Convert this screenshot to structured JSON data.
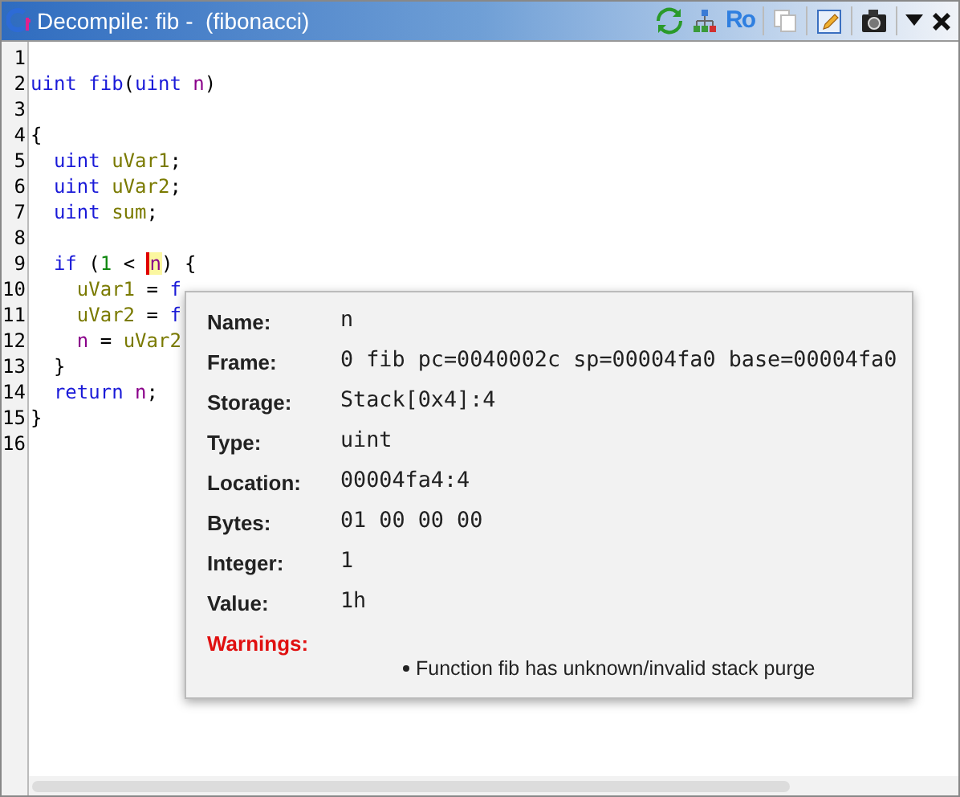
{
  "window": {
    "title": "Decompile: fib -  (fibonacci)"
  },
  "toolbar": {
    "read_only_label": "Ro"
  },
  "code": [
    {
      "number": "1"
    },
    {
      "number": "2",
      "tokens": [
        {
          "kind": "keyword",
          "text": "uint fib"
        },
        {
          "kind": "plain",
          "text": "("
        },
        {
          "kind": "keyword",
          "text": "uint "
        },
        {
          "kind": "param",
          "text": "n"
        },
        {
          "kind": "plain",
          "text": ")"
        }
      ]
    },
    {
      "number": "3"
    },
    {
      "number": "4",
      "tokens": [
        {
          "kind": "plain",
          "text": "{"
        }
      ]
    },
    {
      "number": "5",
      "tokens": [
        {
          "kind": "keyword",
          "text": "  uint "
        },
        {
          "kind": "var",
          "text": "uVar1"
        },
        {
          "kind": "plain",
          "text": ";"
        }
      ]
    },
    {
      "number": "6",
      "tokens": [
        {
          "kind": "keyword",
          "text": "  uint "
        },
        {
          "kind": "var",
          "text": "uVar2"
        },
        {
          "kind": "plain",
          "text": ";"
        }
      ]
    },
    {
      "number": "7",
      "tokens": [
        {
          "kind": "keyword",
          "text": "  uint "
        },
        {
          "kind": "var",
          "text": "sum"
        },
        {
          "kind": "plain",
          "text": ";"
        }
      ]
    },
    {
      "number": "8"
    },
    {
      "number": "9",
      "tokens": [
        {
          "kind": "keyword",
          "text": "  if"
        },
        {
          "kind": "plain",
          "text": " ("
        },
        {
          "kind": "number",
          "text": "1"
        },
        {
          "kind": "plain",
          "text": " < "
        },
        {
          "kind": "param",
          "text": "n",
          "cursor": true
        },
        {
          "kind": "plain",
          "text": ") {"
        }
      ]
    },
    {
      "number": "10",
      "tokens": [
        {
          "kind": "var",
          "text": "    uVar1"
        },
        {
          "kind": "plain",
          "text": " = "
        },
        {
          "kind": "keyword",
          "text": "f"
        }
      ]
    },
    {
      "number": "11",
      "tokens": [
        {
          "kind": "var",
          "text": "    uVar2"
        },
        {
          "kind": "plain",
          "text": " = "
        },
        {
          "kind": "keyword",
          "text": "f"
        }
      ]
    },
    {
      "number": "12",
      "tokens": [
        {
          "kind": "param",
          "text": "    n"
        },
        {
          "kind": "plain",
          "text": " = "
        },
        {
          "kind": "var",
          "text": "uVar2"
        }
      ]
    },
    {
      "number": "13",
      "tokens": [
        {
          "kind": "plain",
          "text": "  }"
        }
      ]
    },
    {
      "number": "14",
      "tokens": [
        {
          "kind": "keyword",
          "text": "  return"
        },
        {
          "kind": "param",
          "text": " n"
        },
        {
          "kind": "plain",
          "text": ";"
        }
      ]
    },
    {
      "number": "15",
      "tokens": [
        {
          "kind": "plain",
          "text": "}"
        }
      ]
    },
    {
      "number": "16"
    }
  ],
  "tooltip": {
    "rows": [
      {
        "label": "Name:",
        "value": "n"
      },
      {
        "label": "Frame:",
        "value": "0 fib pc=0040002c sp=00004fa0 base=00004fa0"
      },
      {
        "label": "Storage:",
        "value": "Stack[0x4]:4"
      },
      {
        "label": "Type:",
        "value": "uint"
      },
      {
        "label": "Location:",
        "value": "00004fa4:4"
      },
      {
        "label": "Bytes:",
        "value": "01 00 00 00"
      },
      {
        "label": "Integer:",
        "value": "1"
      },
      {
        "label": "Value:",
        "value": "1h"
      }
    ],
    "warnings": {
      "label": "Warnings:",
      "items": [
        "Function fib has unknown/invalid stack purge"
      ]
    }
  }
}
